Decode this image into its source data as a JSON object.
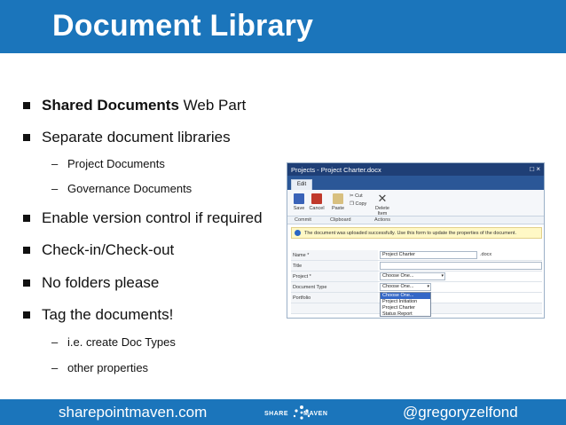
{
  "title": "Document Library",
  "bullets": {
    "item1_bold": "Shared Documents",
    "item1_rest": " Web Part",
    "item2": "Separate document libraries",
    "item2_sub1": "Project Documents",
    "item2_sub2": "Governance Documents",
    "item3": "Enable version control if required",
    "item4": "Check-in/Check-out",
    "item5": "No folders please",
    "item6": "Tag the documents!",
    "item6_sub1": "i.e. create Doc Types",
    "item6_sub2": "other properties",
    "dash": "–"
  },
  "screenshot": {
    "window_title": "Projects - Project Charter.docx",
    "close_glyph": "□ ×",
    "tab_edit": "Edit",
    "ribbon": {
      "save": "Save",
      "cancel": "Cancel",
      "paste": "Paste",
      "cut": "Cut",
      "copy": "Copy",
      "delete_line1": "Delete",
      "delete_line2": "Item"
    },
    "groups": {
      "commit": "Commit",
      "clipboard": "Clipboard",
      "actions": "Actions"
    },
    "info_message": "The document was uploaded successfully. Use this form to update the properties of the document.",
    "fields": {
      "name_label": "Name *",
      "name_value": "Project Charter",
      "name_suffix": ".docx",
      "title_label": "Title",
      "project_label": "Project *",
      "project_value": "Choose One...",
      "doctype_label": "Document Type",
      "doctype_value": "Choose One...",
      "portfolio_label": "Portfolio"
    },
    "dropdown_options": [
      "Choose One...",
      "Project Initiation",
      "Project Charter",
      "Status Report"
    ]
  },
  "footer": {
    "left": "sharepointmaven.com",
    "logo_text_left": "SHARE",
    "logo_text_right": "MAVEN",
    "right": "@gregoryzelfond"
  }
}
